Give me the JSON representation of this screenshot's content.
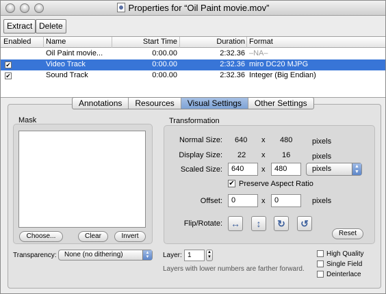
{
  "window": {
    "title": "Properties for “Oil Paint movie.mov”"
  },
  "toolbar": {
    "extract_label": "Extract",
    "delete_label": "Delete"
  },
  "table": {
    "columns": [
      "Enabled",
      "Name",
      "Start Time",
      "Duration",
      "Format"
    ],
    "rows": [
      {
        "enabled": false,
        "name": "Oil Paint movie...",
        "start": "0:00.00",
        "duration": "2:32.36",
        "format": "–NA–"
      },
      {
        "enabled": true,
        "name": "Video Track",
        "start": "0:00.00",
        "duration": "2:32.36",
        "format": "miro DC20 MJPG"
      },
      {
        "enabled": true,
        "name": "Sound Track",
        "start": "0:00.00",
        "duration": "2:32.36",
        "format": "Integer (Big Endian)"
      }
    ],
    "selected_row": 1
  },
  "tabs": [
    {
      "label": "Annotations",
      "active": false
    },
    {
      "label": "Resources",
      "active": false
    },
    {
      "label": "Visual Settings",
      "active": true
    },
    {
      "label": "Other Settings",
      "active": false
    }
  ],
  "mask": {
    "title": "Mask",
    "choose_label": "Choose...",
    "clear_label": "Clear",
    "invert_label": "Invert"
  },
  "transformation": {
    "title": "Transformation",
    "normal_size_label": "Normal Size:",
    "normal_w": "640",
    "normal_h": "480",
    "display_size_label": "Display Size:",
    "display_w": "22",
    "display_h": "16",
    "scaled_size_label": "Scaled Size:",
    "scaled_w": "640",
    "scaled_h": "480",
    "x_sep": "x",
    "pixels": "pixels",
    "units_value": "pixels",
    "preserve_aspect_label": "Preserve Aspect Ratio",
    "preserve_aspect_checked": true,
    "offset_label": "Offset:",
    "offset_x": "0",
    "offset_y": "0",
    "flip_rotate_label": "Flip/Rotate:",
    "reset_label": "Reset"
  },
  "bottom": {
    "transparency_label": "Transparency:",
    "transparency_value": "None (no dithering)",
    "layer_label": "Layer:",
    "layer_value": "1",
    "layer_note": "Layers with lower numbers are farther forward.",
    "high_quality_label": "High Quality",
    "single_field_label": "Single Field",
    "deinterlace_label": "Deinterlace"
  },
  "icons": {
    "flip_horizontal": "flip-horizontal-icon",
    "flip_vertical": "flip-vertical-icon",
    "rotate_clockwise": "rotate-clockwise-icon",
    "rotate_counterclockwise": "rotate-counterclockwise-icon"
  },
  "colors": {
    "selection": "#3875d7",
    "tab_active": "#7ea3d6"
  }
}
